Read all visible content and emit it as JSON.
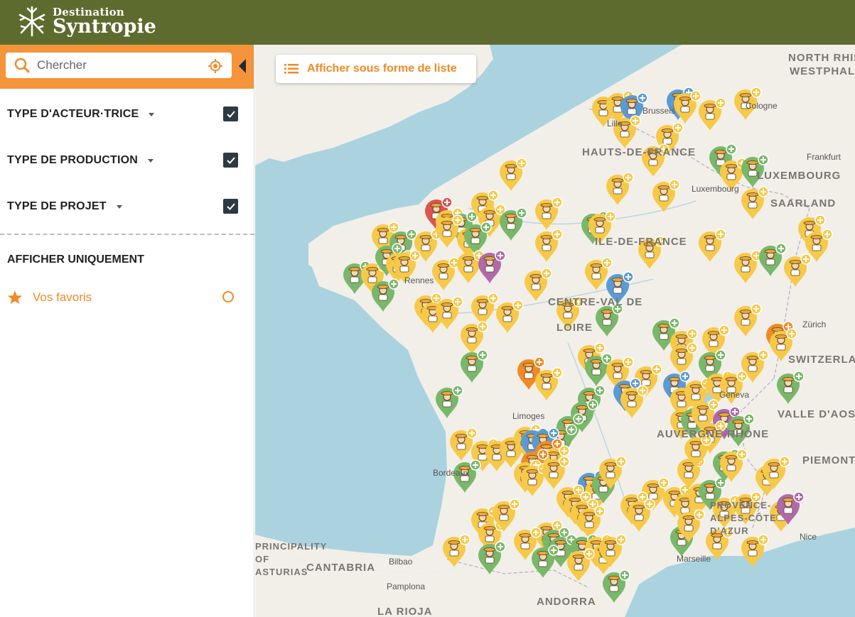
{
  "header": {
    "logo_line1": "Destination",
    "logo_line2": "Syntropie"
  },
  "search": {
    "placeholder": "Chercher"
  },
  "filters": [
    {
      "label": "TYPE D'ACTEUR·TRICE",
      "checked": true
    },
    {
      "label": "TYPE DE PRODUCTION",
      "checked": true
    },
    {
      "label": "TYPE DE PROJET",
      "checked": true
    }
  ],
  "only_section": {
    "title": "AFFICHER UNIQUEMENT",
    "favorites_label": "Vos favoris"
  },
  "map": {
    "list_button_label": "Afficher sous forme de liste",
    "region_labels": [
      "NORTH RHINE-",
      "WESTPHALIA",
      "HAUTS-DE-FRANCE",
      "ILE-DE-FRANCE",
      "CENTRE-VAL DE",
      "LOIRE",
      "SWITZERLAND",
      "VALLE D'AOSTA",
      "PIEMONTE",
      "AUVERGNE-RHÔNE",
      "CANTABRIA",
      "ANDORRA",
      "LA RIOJA",
      "LUXEMBOURG",
      "SAARLAND",
      "PRINCIPALITY OF ASTURIAS",
      "PROVENCE-ALPES-CÔTE D'AZUR"
    ],
    "city_labels": [
      "Brussels",
      "Cologne",
      "Frankfurt",
      "Luxembourg",
      "Rennes",
      "Zürich",
      "Bordeaux",
      "Limoges",
      "Bilbao",
      "Pamplona",
      "Marseille",
      "Nice",
      "Lille",
      "Geneva"
    ],
    "colors": {
      "land": "#f2efe9",
      "sea": "#aad3df",
      "pin_yellow": "#f7c948",
      "pin_green": "#79b86a",
      "pin_blue": "#5b9bd5",
      "pin_orange": "#f08a24",
      "pin_purple": "#b06aa8",
      "pin_red": "#e05252"
    }
  },
  "colors": {
    "header_bg": "#5e6b2e",
    "accent": "#f5943a",
    "checkbox": "#2d3a44"
  }
}
